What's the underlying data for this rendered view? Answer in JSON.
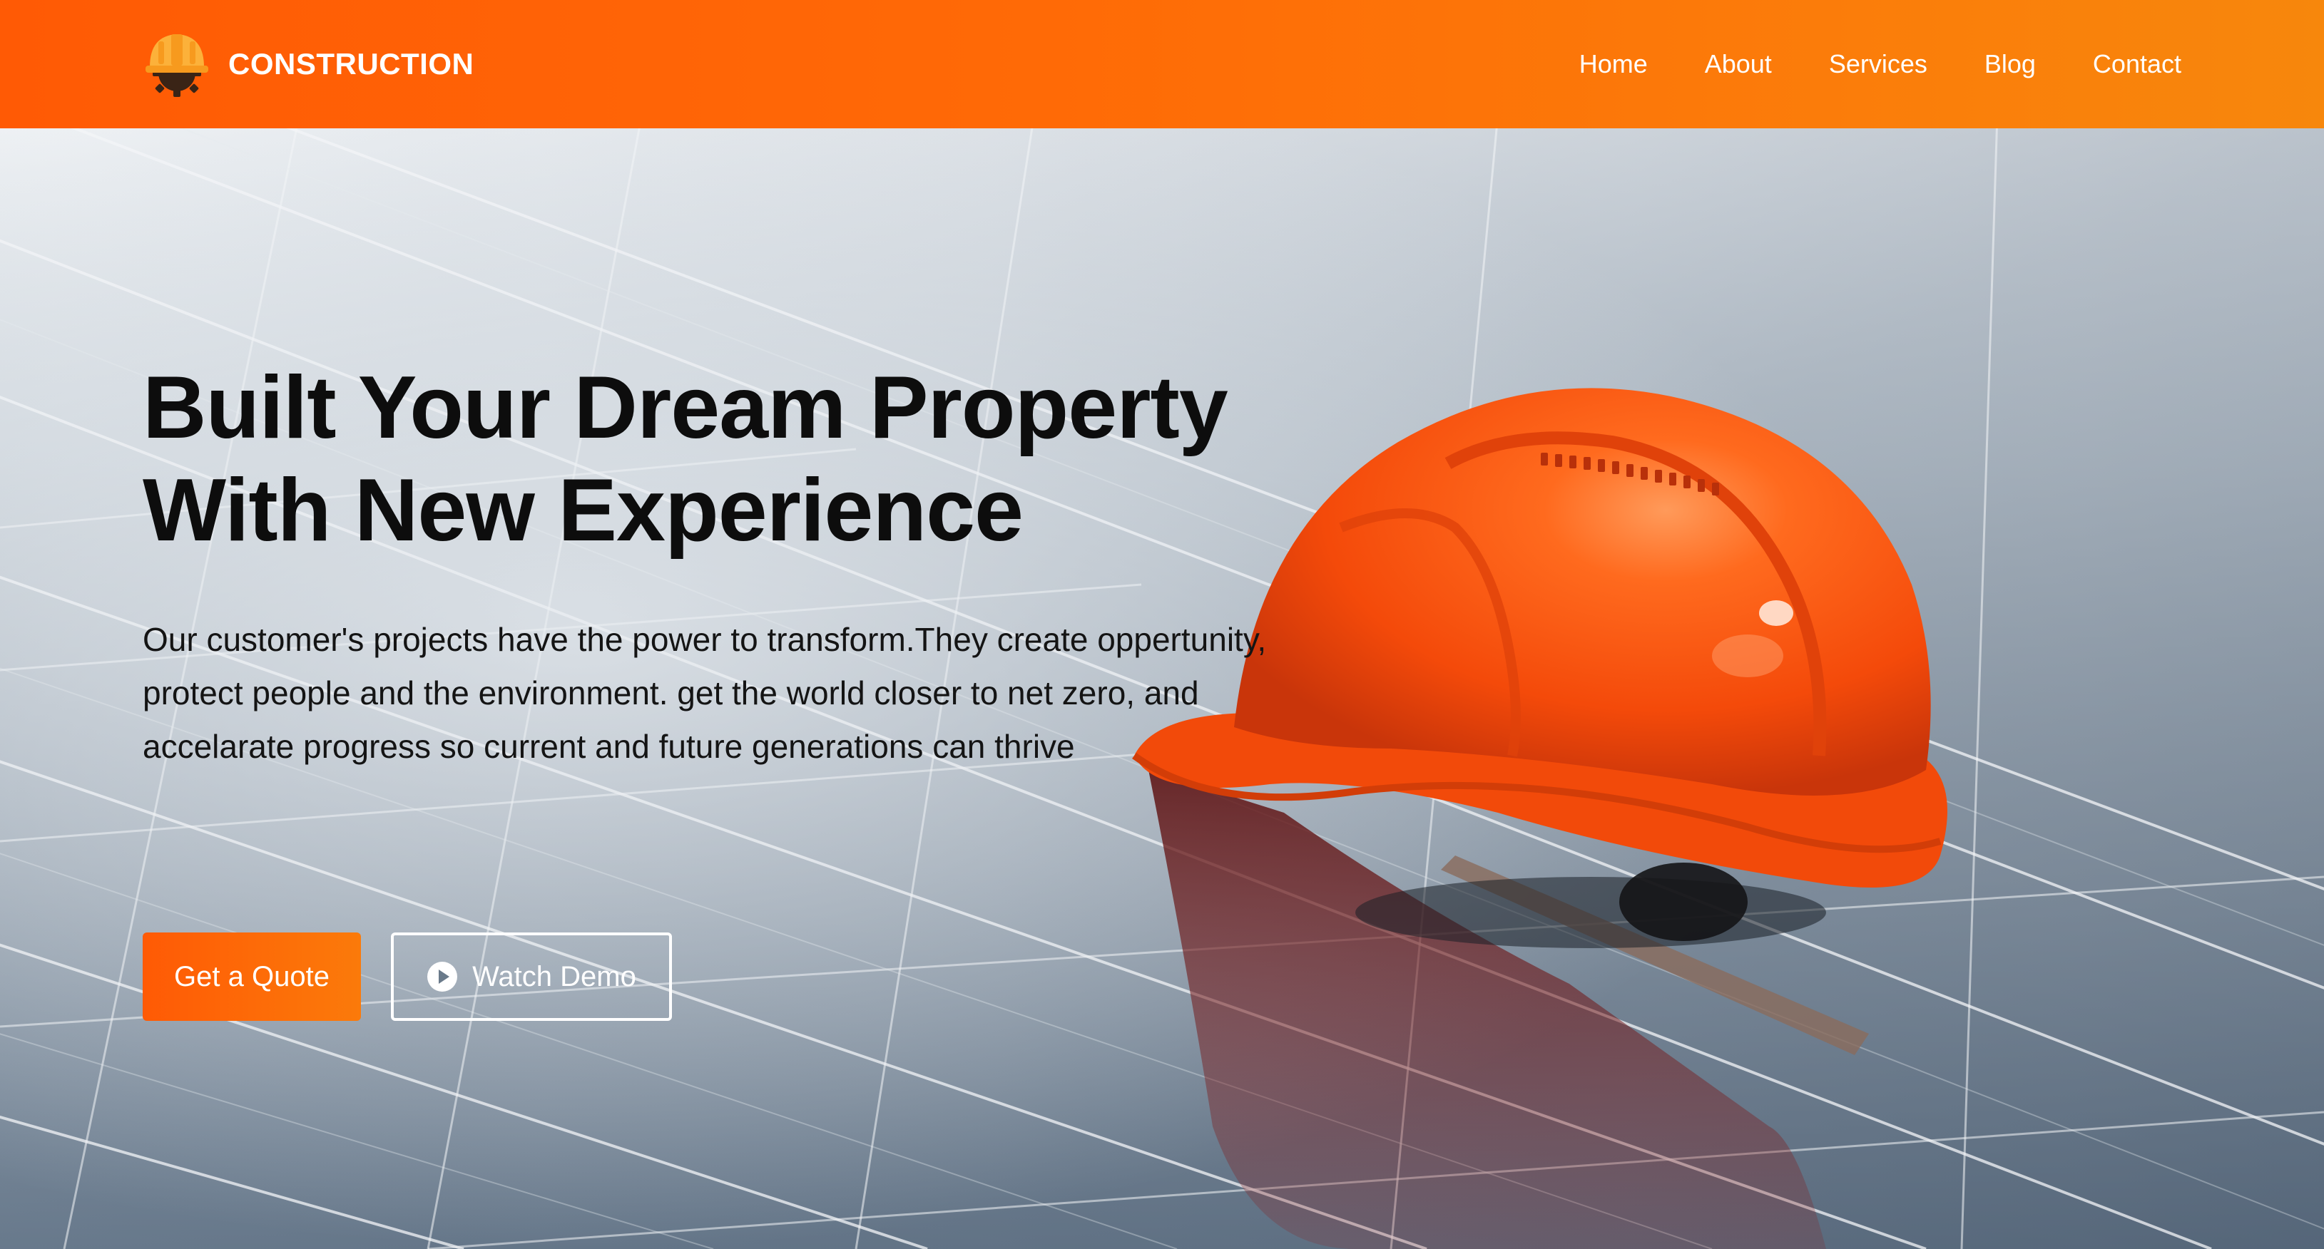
{
  "brand": {
    "name": "CONSTRUCTION",
    "logo_icon": "hard-hat-gear-icon"
  },
  "nav": {
    "items": [
      {
        "label": "Home"
      },
      {
        "label": "About"
      },
      {
        "label": "Services"
      },
      {
        "label": "Blog"
      },
      {
        "label": "Contact"
      }
    ]
  },
  "hero": {
    "title_line1": "Built Your Dream Property",
    "title_line2": "With New Experience",
    "description": "Our customer's projects have the power to transform.They create oppertunity, protect people and the environment. get the world closer to net zero, and accelarate progress so current and future generations can thrive",
    "primary_button": "Get a Quote",
    "secondary_button": "Watch Demo",
    "secondary_icon": "play-circle-icon",
    "background_image": "orange-hard-hat-on-solar-panel-photo"
  },
  "colors": {
    "accent": "#ff5a05",
    "accent_end": "#f7870c",
    "hat": "#ff4d0a"
  }
}
